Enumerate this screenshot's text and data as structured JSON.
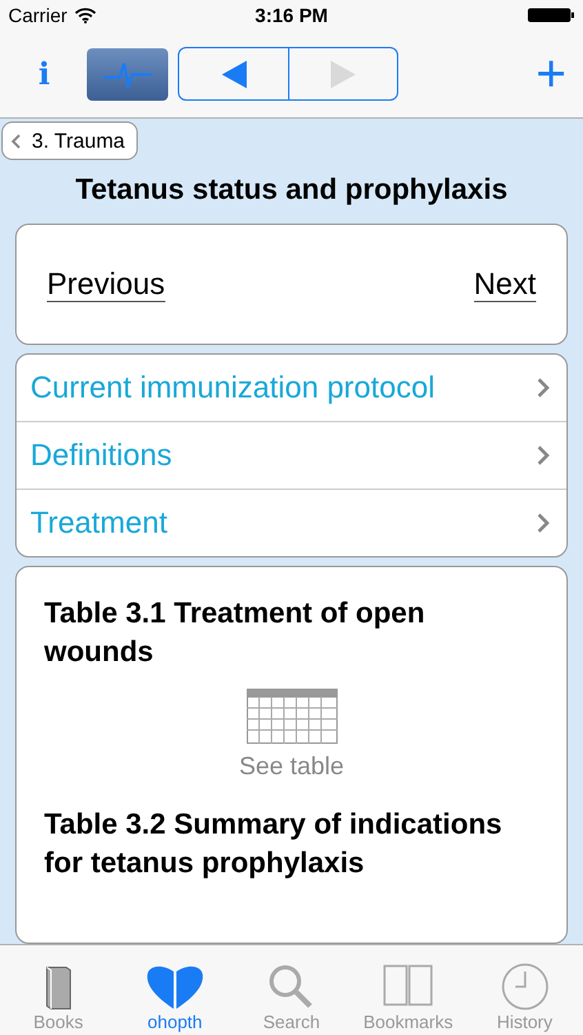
{
  "status_bar": {
    "carrier": "Carrier",
    "time": "3:16 PM"
  },
  "toolbar": {
    "info": "i",
    "monitor_selected": true,
    "back_enabled": true,
    "forward_enabled": false,
    "add": "+"
  },
  "breadcrumb": "3. Trauma",
  "title": "Tetanus status and prophylaxis",
  "nav": {
    "previous": "Previous",
    "next": "Next"
  },
  "sections": [
    "Current immunization protocol",
    "Definitions",
    "Treatment"
  ],
  "tables": [
    {
      "title": "Table 3.1 Treatment of open wounds",
      "link": "See table"
    },
    {
      "title": "Table 3.2 Summary of indications for tetanus prophylaxis"
    }
  ],
  "tab_bar": [
    {
      "label": "Books",
      "kind": "book",
      "selected": false
    },
    {
      "label": "ohopth",
      "kind": "heart",
      "selected": true
    },
    {
      "label": "Search",
      "kind": "search",
      "selected": false
    },
    {
      "label": "Bookmarks",
      "kind": "bookmarks",
      "selected": false
    },
    {
      "label": "History",
      "kind": "clock",
      "selected": false
    }
  ]
}
